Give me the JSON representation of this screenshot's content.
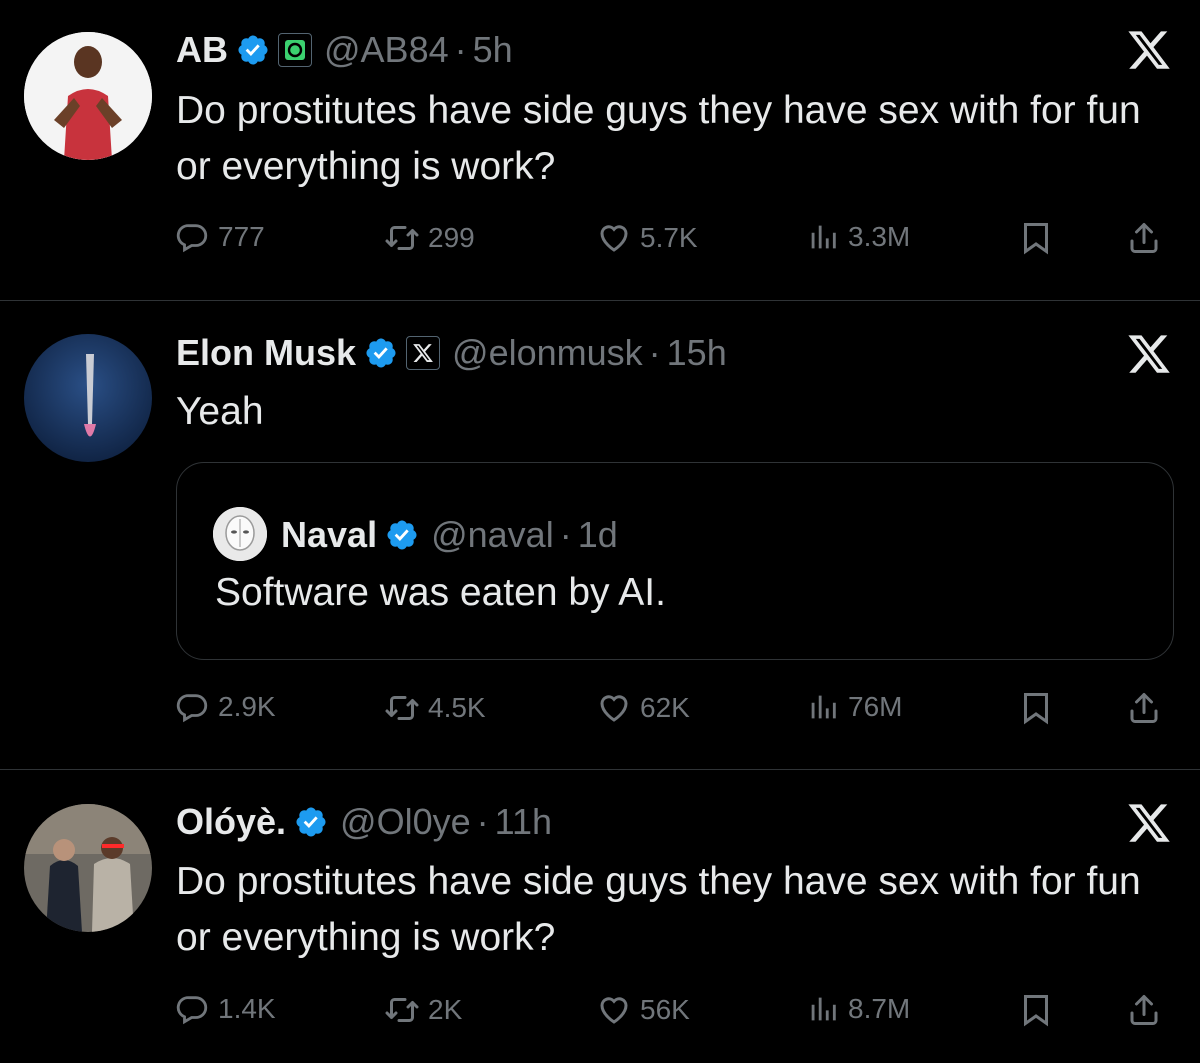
{
  "tweets": [
    {
      "name": "AB",
      "handle": "@AB84",
      "time": "5h",
      "text": "Do prostitutes have side guys they have sex with for fun or everything is work?",
      "replies": "777",
      "reposts": "299",
      "likes": "5.7K",
      "views": "3.3M"
    },
    {
      "name": "Elon Musk",
      "handle": "@elonmusk",
      "time": "15h",
      "text": "Yeah",
      "quote": {
        "name": "Naval",
        "handle": "@naval",
        "time": "1d",
        "text": "Software was eaten by AI."
      },
      "replies": "2.9K",
      "reposts": "4.5K",
      "likes": "62K",
      "views": "76M"
    },
    {
      "name": "Olóyè.",
      "handle": "@Ol0ye",
      "time": "11h",
      "text": "Do prostitutes have side guys they have sex with for fun or everything is work?",
      "replies": "1.4K",
      "reposts": "2K",
      "likes": "56K",
      "views": "8.7M"
    }
  ],
  "separator": "·",
  "icons": {
    "verified": "verified-badge-icon",
    "platform": "x-logo-icon",
    "reply": "reply-icon",
    "repost": "repost-icon",
    "like": "heart-icon",
    "views": "views-icon",
    "bookmark": "bookmark-icon",
    "share": "share-icon"
  },
  "colors": {
    "background": "#000000",
    "text": "#e7e9ea",
    "muted": "#71767b",
    "verified": "#1d9bf0",
    "divider": "#2f3336"
  }
}
